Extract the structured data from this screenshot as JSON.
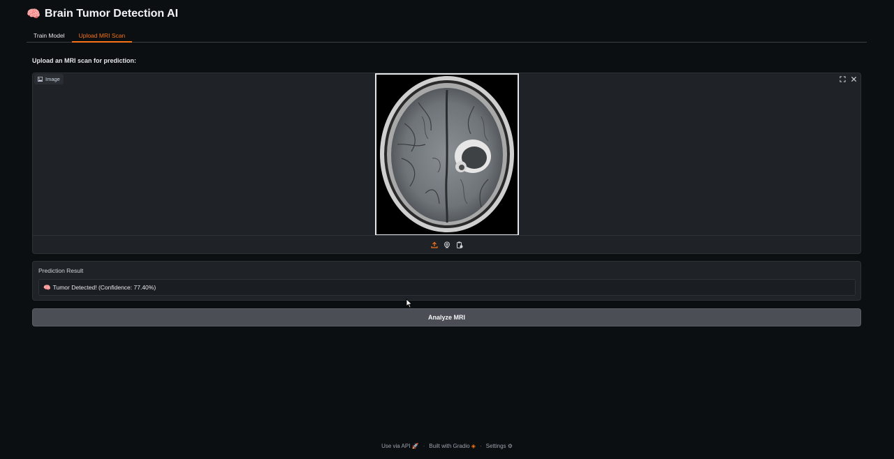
{
  "header": {
    "emoji": "🧠",
    "title": "Brain Tumor Detection AI"
  },
  "tabs": [
    {
      "label": "Train Model",
      "active": false
    },
    {
      "label": "Upload MRI Scan",
      "active": true
    }
  ],
  "upload": {
    "section_label": "Upload an MRI scan for prediction:",
    "image_label": "Image",
    "source_icons": [
      "upload-icon",
      "webcam-icon",
      "clipboard-icon"
    ],
    "top_icons": [
      "fullscreen-icon",
      "close-icon"
    ]
  },
  "prediction": {
    "label": "Prediction Result",
    "emoji": "🧠",
    "value": "Tumor Detected! (Confidence: 77.40%)"
  },
  "analyze_button": {
    "label": "Analyze MRI"
  },
  "footer": {
    "api_label": "Use via API",
    "gradio_label": "Built with Gradio",
    "settings_label": "Settings",
    "separator": "·"
  },
  "colors": {
    "accent": "#f97316",
    "background": "#0c0f11",
    "panel": "#1f2226"
  }
}
